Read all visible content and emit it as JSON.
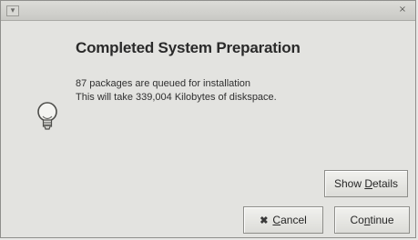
{
  "window": {
    "titlebar_menu_icon": "menu-arrow-icon",
    "titlebar_close_icon": "close-icon"
  },
  "dialog": {
    "title": "Completed System Preparation",
    "message_line_1": "87 packages are queued for installation",
    "message_line_2": "This will take 339,004 Kilobytes of diskspace.",
    "hint_icon": "lightbulb-icon"
  },
  "buttons": {
    "show_details": {
      "label_before": "Show ",
      "label_underlined": "D",
      "label_after": "etails"
    },
    "cancel": {
      "icon": "cancel-x-icon",
      "label_underlined": "C",
      "label_after": "ancel"
    },
    "continue": {
      "label_before": "Co",
      "label_underlined": "n",
      "label_after": "tinue"
    }
  },
  "colors": {
    "window_bg": "#e3e3e0",
    "titlebar": "#cfcfcb",
    "text": "#2a2a2a"
  }
}
